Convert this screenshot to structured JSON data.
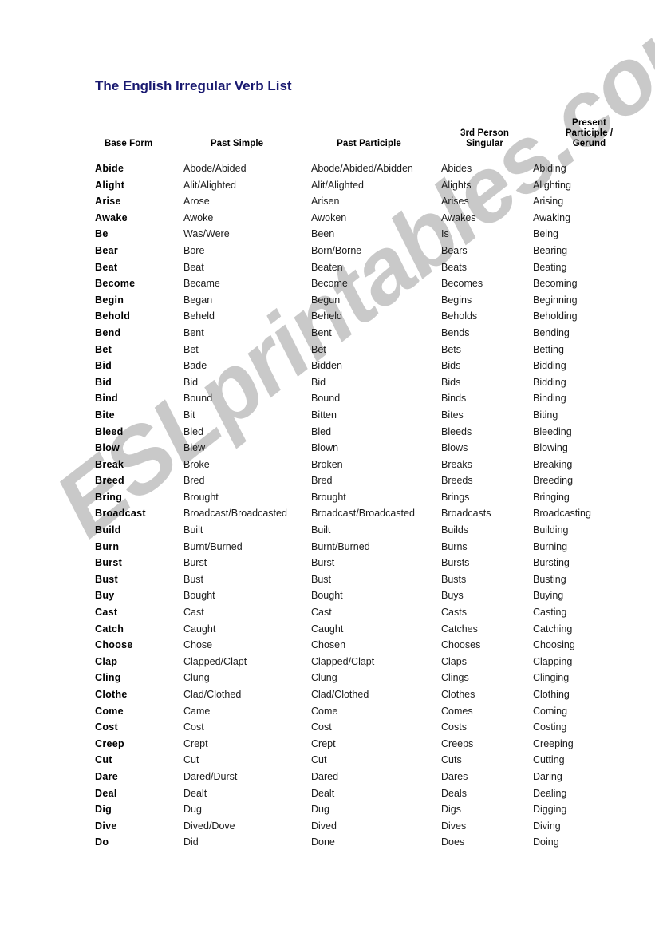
{
  "document": {
    "title": "The English Irregular Verb List",
    "title_color": "#191970",
    "watermark": "ESLprintables.com"
  },
  "table": {
    "headers": [
      "Base Form",
      "Past Simple",
      "Past Participle",
      "3rd Person Singular",
      "Present Participle / Gerund"
    ],
    "headers_lines": [
      [
        "Base Form"
      ],
      [
        "Past Simple"
      ],
      [
        "Past Participle"
      ],
      [
        "3rd Person",
        "Singular"
      ],
      [
        "Present",
        "Participle /",
        "Gerund"
      ]
    ],
    "rows": [
      [
        "Abide",
        "Abode/Abided",
        "Abode/Abided/Abidden",
        "Abides",
        "Abiding"
      ],
      [
        "Alight",
        "Alit/Alighted",
        "Alit/Alighted",
        "Alights",
        "Alighting"
      ],
      [
        "Arise",
        "Arose",
        "Arisen",
        "Arises",
        "Arising"
      ],
      [
        "Awake",
        "Awoke",
        "Awoken",
        "Awakes",
        "Awaking"
      ],
      [
        "Be",
        "Was/Were",
        "Been",
        "Is",
        "Being"
      ],
      [
        "Bear",
        "Bore",
        "Born/Borne",
        "Bears",
        "Bearing"
      ],
      [
        "Beat",
        "Beat",
        "Beaten",
        "Beats",
        "Beating"
      ],
      [
        "Become",
        "Became",
        "Become",
        "Becomes",
        "Becoming"
      ],
      [
        "Begin",
        "Began",
        "Begun",
        "Begins",
        "Beginning"
      ],
      [
        "Behold",
        "Beheld",
        "Beheld",
        "Beholds",
        "Beholding"
      ],
      [
        "Bend",
        "Bent",
        "Bent",
        "Bends",
        "Bending"
      ],
      [
        "Bet",
        "Bet",
        "Bet",
        "Bets",
        "Betting"
      ],
      [
        "Bid",
        "Bade",
        "Bidden",
        "Bids",
        "Bidding"
      ],
      [
        "Bid",
        "Bid",
        "Bid",
        "Bids",
        "Bidding"
      ],
      [
        "Bind",
        "Bound",
        "Bound",
        "Binds",
        "Binding"
      ],
      [
        "Bite",
        "Bit",
        "Bitten",
        "Bites",
        "Biting"
      ],
      [
        "Bleed",
        "Bled",
        "Bled",
        "Bleeds",
        "Bleeding"
      ],
      [
        "Blow",
        "Blew",
        "Blown",
        "Blows",
        "Blowing"
      ],
      [
        "Break",
        "Broke",
        "Broken",
        "Breaks",
        "Breaking"
      ],
      [
        "Breed",
        "Bred",
        "Bred",
        "Breeds",
        "Breeding"
      ],
      [
        "Bring",
        "Brought",
        "Brought",
        "Brings",
        "Bringing"
      ],
      [
        "Broadcast",
        "Broadcast/Broadcasted",
        "Broadcast/Broadcasted",
        "Broadcasts",
        "Broadcasting"
      ],
      [
        "Build",
        "Built",
        "Built",
        "Builds",
        "Building"
      ],
      [
        "Burn",
        "Burnt/Burned",
        "Burnt/Burned",
        "Burns",
        "Burning"
      ],
      [
        "Burst",
        "Burst",
        "Burst",
        "Bursts",
        "Bursting"
      ],
      [
        "Bust",
        "Bust",
        "Bust",
        "Busts",
        "Busting"
      ],
      [
        "Buy",
        "Bought",
        "Bought",
        "Buys",
        "Buying"
      ],
      [
        "Cast",
        "Cast",
        "Cast",
        "Casts",
        "Casting"
      ],
      [
        "Catch",
        "Caught",
        "Caught",
        "Catches",
        "Catching"
      ],
      [
        "Choose",
        "Chose",
        "Chosen",
        "Chooses",
        "Choosing"
      ],
      [
        "Clap",
        "Clapped/Clapt",
        "Clapped/Clapt",
        "Claps",
        "Clapping"
      ],
      [
        "Cling",
        "Clung",
        "Clung",
        "Clings",
        "Clinging"
      ],
      [
        "Clothe",
        "Clad/Clothed",
        "Clad/Clothed",
        "Clothes",
        "Clothing"
      ],
      [
        "Come",
        "Came",
        "Come",
        "Comes",
        "Coming"
      ],
      [
        "Cost",
        "Cost",
        "Cost",
        "Costs",
        "Costing"
      ],
      [
        "Creep",
        "Crept",
        "Crept",
        "Creeps",
        "Creeping"
      ],
      [
        "Cut",
        "Cut",
        "Cut",
        "Cuts",
        "Cutting"
      ],
      [
        "Dare",
        "Dared/Durst",
        "Dared",
        "Dares",
        "Daring"
      ],
      [
        "Deal",
        "Dealt",
        "Dealt",
        "Deals",
        "Dealing"
      ],
      [
        "Dig",
        "Dug",
        "Dug",
        "Digs",
        "Digging"
      ],
      [
        "Dive",
        "Dived/Dove",
        "Dived",
        "Dives",
        "Diving"
      ],
      [
        "Do",
        "Did",
        "Done",
        "Does",
        "Doing"
      ]
    ]
  }
}
